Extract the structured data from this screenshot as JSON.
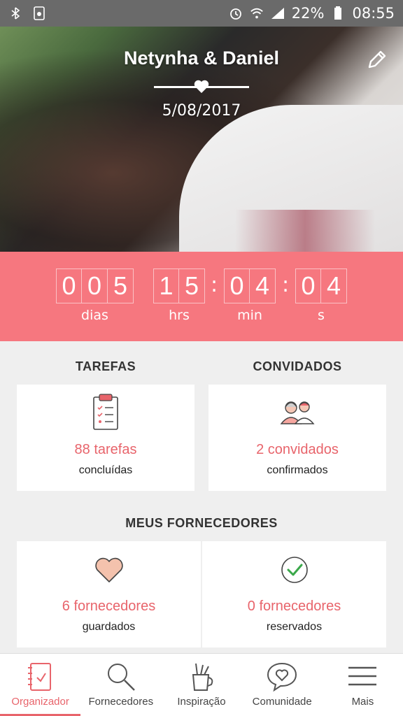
{
  "status_bar": {
    "battery_percent": "22%",
    "time": "08:55",
    "icons": [
      "bluetooth-icon",
      "screenshot-icon",
      "alarm-icon",
      "wifi-icon",
      "signal-icon",
      "battery-icon"
    ]
  },
  "hero": {
    "couple_names": "Netynha & Daniel",
    "wedding_date": "5/08/2017",
    "edit_icon": "pencil-icon"
  },
  "countdown": {
    "days": [
      "0",
      "0",
      "5"
    ],
    "hours": [
      "1",
      "5"
    ],
    "minutes": [
      "0",
      "4"
    ],
    "seconds": [
      "0",
      "4"
    ],
    "separator": ":",
    "labels": {
      "days": "dias",
      "hours": "hrs",
      "minutes": "min",
      "seconds": "s"
    }
  },
  "tasks": {
    "title": "TAREFAS",
    "value": "88 tarefas",
    "subtitle": "concluídas",
    "icon": "clipboard-icon"
  },
  "guests": {
    "title": "CONVIDADOS",
    "value": "2 convidados",
    "subtitle": "confirmados",
    "icon": "couple-icon"
  },
  "vendors": {
    "title": "MEUS FORNECEDORES",
    "saved": {
      "value": "6 fornecedores",
      "subtitle": "guardados",
      "icon": "heart-icon"
    },
    "booked": {
      "value": "0 fornecedores",
      "subtitle": "reservados",
      "icon": "check-circle-icon"
    }
  },
  "bottom_nav": {
    "active": "Organizador",
    "items": [
      {
        "label": "Organizador",
        "icon": "notebook-icon"
      },
      {
        "label": "Fornecedores",
        "icon": "search-icon"
      },
      {
        "label": "Inspiração",
        "icon": "pencil-cup-icon"
      },
      {
        "label": "Comunidade",
        "icon": "chat-heart-icon"
      },
      {
        "label": "Mais",
        "icon": "menu-icon"
      }
    ]
  },
  "colors": {
    "accent": "#f6777f",
    "accent_text": "#e8646b",
    "status_bar": "#6a6a6a"
  }
}
